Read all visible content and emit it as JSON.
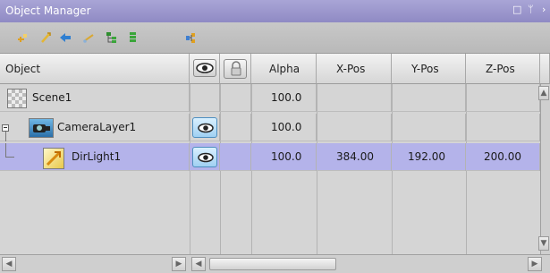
{
  "window": {
    "title": "Object Manager",
    "restore_glyph": "□",
    "pin_glyph": "ᛘ",
    "close_glyph": "›"
  },
  "toolbar": {
    "icons": [
      "add-layer-icon",
      "add-light-icon",
      "arrow-left-icon",
      "link-icon",
      "tree-expand-icon",
      "tree-collapse-icon",
      "hierarchy-icon"
    ]
  },
  "columns": {
    "object": "Object",
    "visibility_icon": "eye-icon",
    "lock_icon": "lock-icon",
    "alpha": "Alpha",
    "xpos": "X-Pos",
    "ypos": "Y-Pos",
    "zpos": "Z-Pos"
  },
  "rows": [
    {
      "name": "Scene1",
      "icon": "scene-icon",
      "visible_toggle": false,
      "alpha": "100.0",
      "x": "",
      "y": "",
      "z": "",
      "selected": false
    },
    {
      "name": "CameraLayer1",
      "icon": "camera-layer-icon",
      "visible_toggle": true,
      "alpha": "100.0",
      "x": "",
      "y": "",
      "z": "",
      "selected": false,
      "expanded": true
    },
    {
      "name": "DirLight1",
      "icon": "directional-light-icon",
      "visible_toggle": true,
      "alpha": "100.0",
      "x": "384.00",
      "y": "192.00",
      "z": "200.00",
      "selected": true
    }
  ],
  "colors": {
    "title_bar": "#8f8ac4",
    "selected_row": "#b4b3ea",
    "eye_button": "#9fd0f2"
  }
}
